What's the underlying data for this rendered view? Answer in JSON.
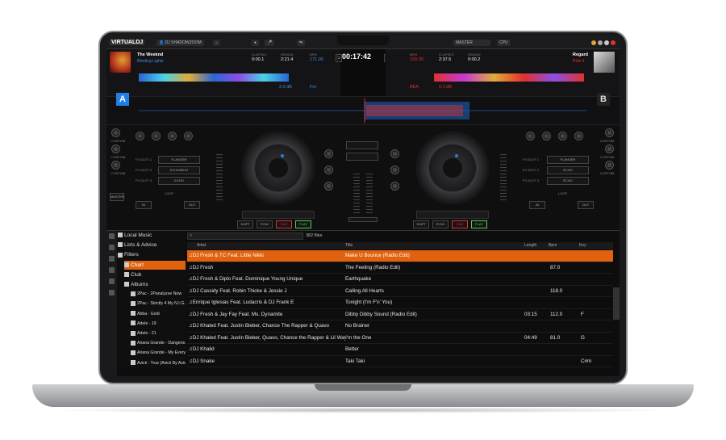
{
  "app": {
    "logo": "VIRTUALDJ",
    "account": "DJ SHADOWZOOM",
    "master": "MASTER"
  },
  "colors": {
    "accent": "#e0620f",
    "blue": "#1e7fe6",
    "red": "#e13030"
  },
  "clock": "00:17:42",
  "deckA": {
    "letter": "A",
    "title": "The Weeknd",
    "artist": "Blinding Lights",
    "stats": [
      {
        "label": "ELAPSED",
        "value": "0:00.1"
      },
      {
        "label": "REMAIN",
        "value": "2:21.4"
      },
      {
        "label": "BPM",
        "value": "171.00"
      }
    ],
    "key": "2.0 dB",
    "pitch": "Fm",
    "fx_slots": [
      "FX SLOT 1",
      "FX SLOT 2",
      "FX SLOT 3"
    ],
    "fx_names": [
      "FLANGER",
      "ECHO/BEAT",
      "ECHO"
    ],
    "buttons": [
      "CUSTOM",
      "CUSTOM",
      "CUSTOM"
    ],
    "transport": [
      "SHIFT",
      "SYNC",
      "CUE",
      "PLAY"
    ],
    "loop": "LOOP",
    "loop_btns": [
      "IN",
      "OUT"
    ],
    "master": "MASTER"
  },
  "deckB": {
    "letter": "B",
    "title": "Regard",
    "artist": "Ride It",
    "stats": [
      {
        "label": "BPM",
        "value": "100.00"
      },
      {
        "label": "ELAPSED",
        "value": "2:37.5"
      },
      {
        "label": "REMAIN",
        "value": "0:00.2"
      }
    ],
    "key": "BEA",
    "pitch": "0.1 dB",
    "fx_slots": [
      "FX SLOT 1",
      "FX SLOT 2",
      "FX SLOT 3"
    ],
    "fx_names": [
      "FLANGER",
      "ECHO",
      "ECHO"
    ],
    "buttons": [
      "CUSTOM",
      "CUSTOM",
      "CUSTOM"
    ],
    "transport": [
      "SHIFT",
      "SYNC",
      "CUE",
      "PLAY"
    ],
    "loop": "LOOP",
    "loop_btns": [
      "IN",
      "OUT"
    ]
  },
  "browser": {
    "search_placeholder": "",
    "count": "382 files",
    "tree": [
      {
        "label": "Local Music",
        "indent": 0,
        "selected": false
      },
      {
        "label": "Lists & Advice",
        "indent": 0,
        "selected": false
      },
      {
        "label": "Filters",
        "indent": 0,
        "selected": false
      },
      {
        "label": "Chart",
        "indent": 1,
        "selected": true
      },
      {
        "label": "Club",
        "indent": 1,
        "selected": false
      },
      {
        "label": "Albums",
        "indent": 1,
        "selected": false
      },
      {
        "label": "2Pac - 2Panalyzse Now",
        "indent": 2,
        "selected": false
      },
      {
        "label": "2Pac - Strictly 4 My N.I.G.G.",
        "indent": 2,
        "selected": false
      },
      {
        "label": "Abba - Gold",
        "indent": 2,
        "selected": false
      },
      {
        "label": "Adele - 19",
        "indent": 2,
        "selected": false
      },
      {
        "label": "Adele - 21",
        "indent": 2,
        "selected": false
      },
      {
        "label": "Ariana Grande - Dangerous W",
        "indent": 2,
        "selected": false
      },
      {
        "label": "Ariana Grande - My Everythin",
        "indent": 2,
        "selected": false
      },
      {
        "label": "Avicii - True (Avicii By Avicii)",
        "indent": 2,
        "selected": false
      }
    ],
    "columns": {
      "artist": "Artist",
      "title": "Title",
      "length": "Length",
      "bpm": "Bpm",
      "key": "Key"
    },
    "rows": [
      {
        "artist": "DJ Fresh & TC Feat. Little Nikki",
        "title": "Make U Bounce (Radio Edit)",
        "length": "",
        "bpm": "",
        "key": "",
        "selected": true
      },
      {
        "artist": "DJ Fresh",
        "title": "The Feeling (Radio Edit)",
        "length": "",
        "bpm": "87.0",
        "key": "",
        "selected": false
      },
      {
        "artist": "DJ Fresh & Diplo Feat. Dominique Young Unique",
        "title": "Earthquake",
        "length": "",
        "bpm": "",
        "key": "",
        "selected": false
      },
      {
        "artist": "DJ Cassidy Feat. Robin Thicke & Jessie J",
        "title": "Calling All Hearts",
        "length": "",
        "bpm": "118.0",
        "key": "",
        "selected": false
      },
      {
        "artist": "Enrique Iglesias Feat. Ludacris & DJ Frank E",
        "title": "Tonight (I'm F'n' You)",
        "length": "",
        "bpm": "",
        "key": "",
        "selected": false
      },
      {
        "artist": "DJ Fresh & Jay Fay Feat. Ms. Dynamite",
        "title": "Dibby Dibby Sound (Radio Edit)",
        "length": "03:15",
        "bpm": "112.0",
        "key": "F",
        "selected": false
      },
      {
        "artist": "DJ Khaled Feat. Justin Bieber, Chance The Rapper & Quavo",
        "title": "No Brainer",
        "length": "",
        "bpm": "",
        "key": "",
        "selected": false
      },
      {
        "artist": "DJ Khaled Feat. Justin Bieber, Quavo, Chance the Rapper & Lil Wayne",
        "title": "I'm the One",
        "length": "04:49",
        "bpm": "81.0",
        "key": "G",
        "selected": false
      },
      {
        "artist": "DJ Khalid",
        "title": "Better",
        "length": "",
        "bpm": "",
        "key": "",
        "selected": false
      },
      {
        "artist": "DJ Snake",
        "title": "Taki Taki",
        "length": "",
        "bpm": "",
        "key": "C#m",
        "selected": false
      }
    ]
  }
}
